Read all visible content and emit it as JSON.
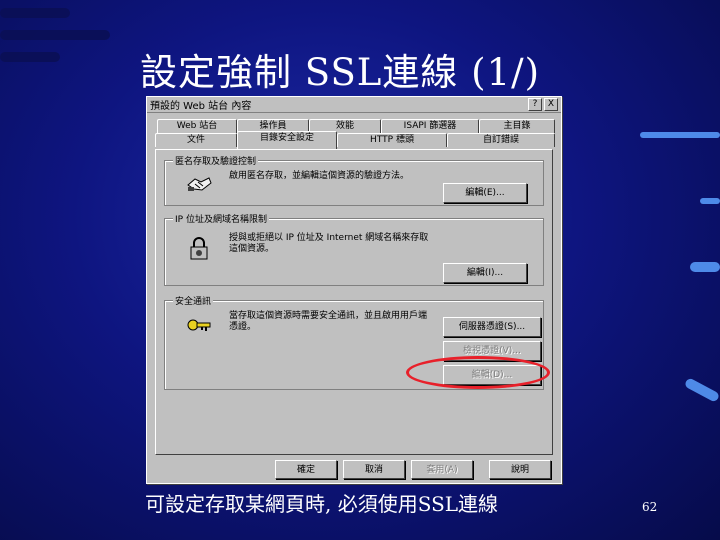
{
  "slide": {
    "title": "設定強制 SSL連線 (1/)",
    "caption": "可設定存取某網頁時, 必須使用SSL連線",
    "page_number": "62"
  },
  "dialog": {
    "title": "預設的 Web 站台 內容",
    "help_symbol": "?",
    "close_symbol": "X",
    "tabs_row1": [
      "Web 站台",
      "操作員",
      "效能",
      "ISAPI 篩選器",
      "主目錄"
    ],
    "tabs_row2": [
      "文件",
      "目錄安全設定",
      "HTTP 標頭",
      "自訂錯誤"
    ],
    "active_tab": "目錄安全設定",
    "groups": {
      "anonymous": {
        "label": "匿名存取及驗證控制",
        "text": "啟用匿名存取，並編輯這個資源的驗證方法。",
        "button": "編輯(E)..."
      },
      "ip": {
        "label": "IP 位址及網域名稱限制",
        "text": "授與或拒絕以 IP 位址及 Internet 網域名稱來存取這個資源。",
        "button": "編輯(I)..."
      },
      "secure": {
        "label": "安全通訊",
        "text": "當存取這個資源時需要安全通訊，並且啟用用戶端憑證。",
        "server_cert_button": "伺服器憑證(S)...",
        "view_cert_button": "檢視憑證(V)...",
        "edit_button": "編輯(D)..."
      }
    },
    "bottom_buttons": [
      "確定",
      "取消",
      "套用(A)",
      "說明"
    ]
  },
  "colors": {
    "highlight": "#e8202a",
    "dialog_face": "#c0c0c0"
  }
}
